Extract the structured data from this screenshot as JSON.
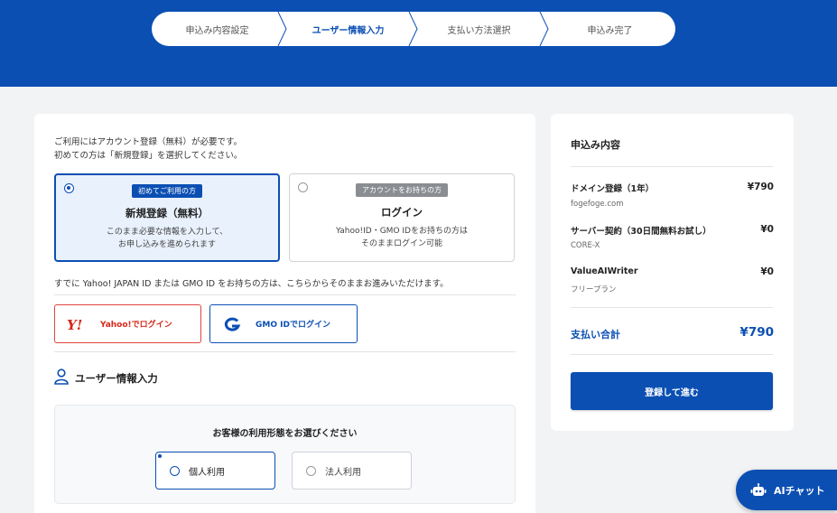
{
  "stepper": {
    "steps": [
      {
        "label": "申込み内容設定",
        "active": false
      },
      {
        "label": "ユーザー情報入力",
        "active": true
      },
      {
        "label": "支払い方法選択",
        "active": false
      },
      {
        "label": "申込み完了",
        "active": false
      }
    ]
  },
  "account": {
    "intro_line1": "ご利用にはアカウント登録（無料）が必要です。",
    "intro_line2": "初めての方は「新規登録」を選択してください。",
    "new": {
      "badge": "初めてご利用の方",
      "title": "新規登録（無料）",
      "desc_line1": "このまま必要な情報を入力して、",
      "desc_line2": "お申し込みを進められます",
      "selected": true
    },
    "login": {
      "badge": "アカウントをお持ちの方",
      "title": "ログイン",
      "desc_line1": "Yahoo!ID・GMO IDをお持ちの方は",
      "desc_line2": "そのままログイン可能",
      "selected": false
    },
    "notice": "すでに Yahoo! JAPAN ID または GMO ID をお持ちの方は、こちらからそのままお進みいただけます。",
    "yahoo_label": "Yahoo!でログイン",
    "gmo_label": "GMO IDでログイン"
  },
  "user_info": {
    "title": "ユーザー情報入力",
    "question": "お客様の利用形態をお選びください",
    "options": [
      {
        "label": "個人利用",
        "selected": true
      },
      {
        "label": "法人利用",
        "selected": false
      }
    ]
  },
  "summary": {
    "title": "申込み内容",
    "items": [
      {
        "name": "ドメイン登録（1年）",
        "price": "¥790",
        "sub": "fogefoge.com"
      },
      {
        "name": "サーバー契約（30日間無料お試し）",
        "price": "¥0",
        "sub": "CORE-X"
      },
      {
        "name": "ValueAIWriter",
        "price": "¥0",
        "sub": "フリープラン"
      }
    ],
    "total_label": "支払い合計",
    "total_price": "¥790",
    "submit_label": "登録して進む"
  },
  "chat": {
    "label": "AIチャット"
  },
  "colors": {
    "primary": "#0b4fb3",
    "yahoo_red": "#d7271b",
    "background": "#f2f3f5"
  }
}
